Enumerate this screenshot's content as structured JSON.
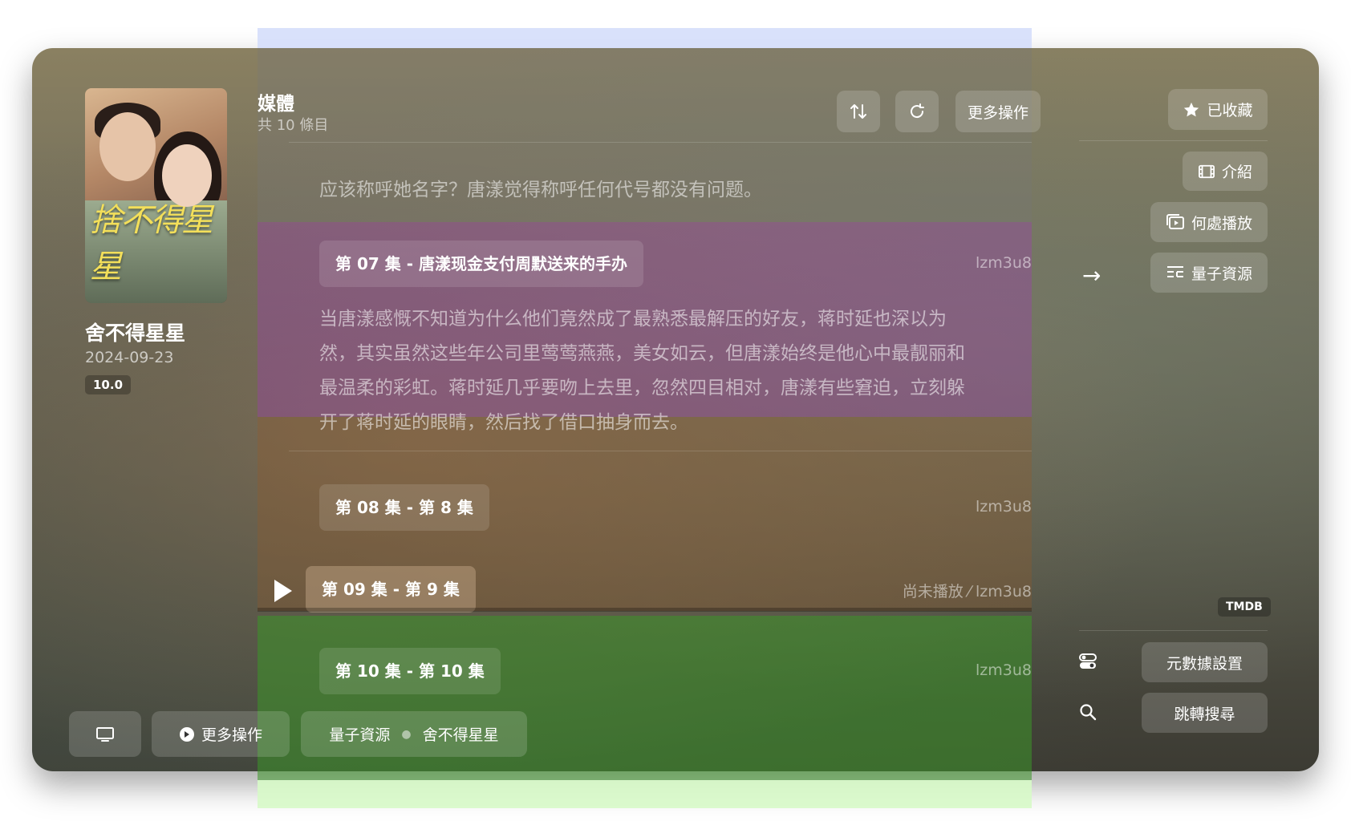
{
  "show": {
    "title": "舍不得星星",
    "date": "2024-09-23",
    "rating": "10.0",
    "poster_title": "捨不得星星"
  },
  "media": {
    "title": "媒體",
    "count": "共 10 條目",
    "more_actions": "更多操作"
  },
  "right_panel": {
    "favorited": "已收藏",
    "intro": "介紹",
    "where_play": "何處播放",
    "source": "量子資源",
    "tmdb": "TMDB",
    "metadata_settings": "元數據設置",
    "jump_search": "跳轉搜尋"
  },
  "episodes": {
    "prev_desc_tail": "应该称呼她名字？唐漾觉得称呼任何代号都没有问题。",
    "items": [
      {
        "label": "第 07 集 - 唐漾现金支付周默送来的手办",
        "meta": "lzm3u8",
        "desc": "当唐漾感慨不知道为什么他们竟然成了最熟悉最解压的好友，蒋时延也深以为然，其实虽然这些年公司里莺莺燕燕，美女如云，但唐漾始终是他心中最靓丽和最温柔的彩虹。蒋时延几乎要吻上去里，忽然四目相对，唐漾有些窘迫，立刻躲开了蒋时延的眼睛，然后找了借口抽身而去。"
      },
      {
        "label": "第 08 集 - 第 8 集",
        "meta": "lzm3u8"
      },
      {
        "label": "第 09 集 - 第 9 集",
        "meta": "尚未播放 ⁄ lzm3u8"
      },
      {
        "label": "第 10 集 - 第 10 集",
        "meta": "lzm3u8"
      }
    ]
  },
  "bottom_bar": {
    "more_actions": "更多操作",
    "source": "量子資源",
    "show": "舍不得星星"
  },
  "colors": {
    "overlay_purple": "#a03cb4",
    "overlay_green": "#3c9628",
    "overlay_blue": "#d2dcfa"
  }
}
